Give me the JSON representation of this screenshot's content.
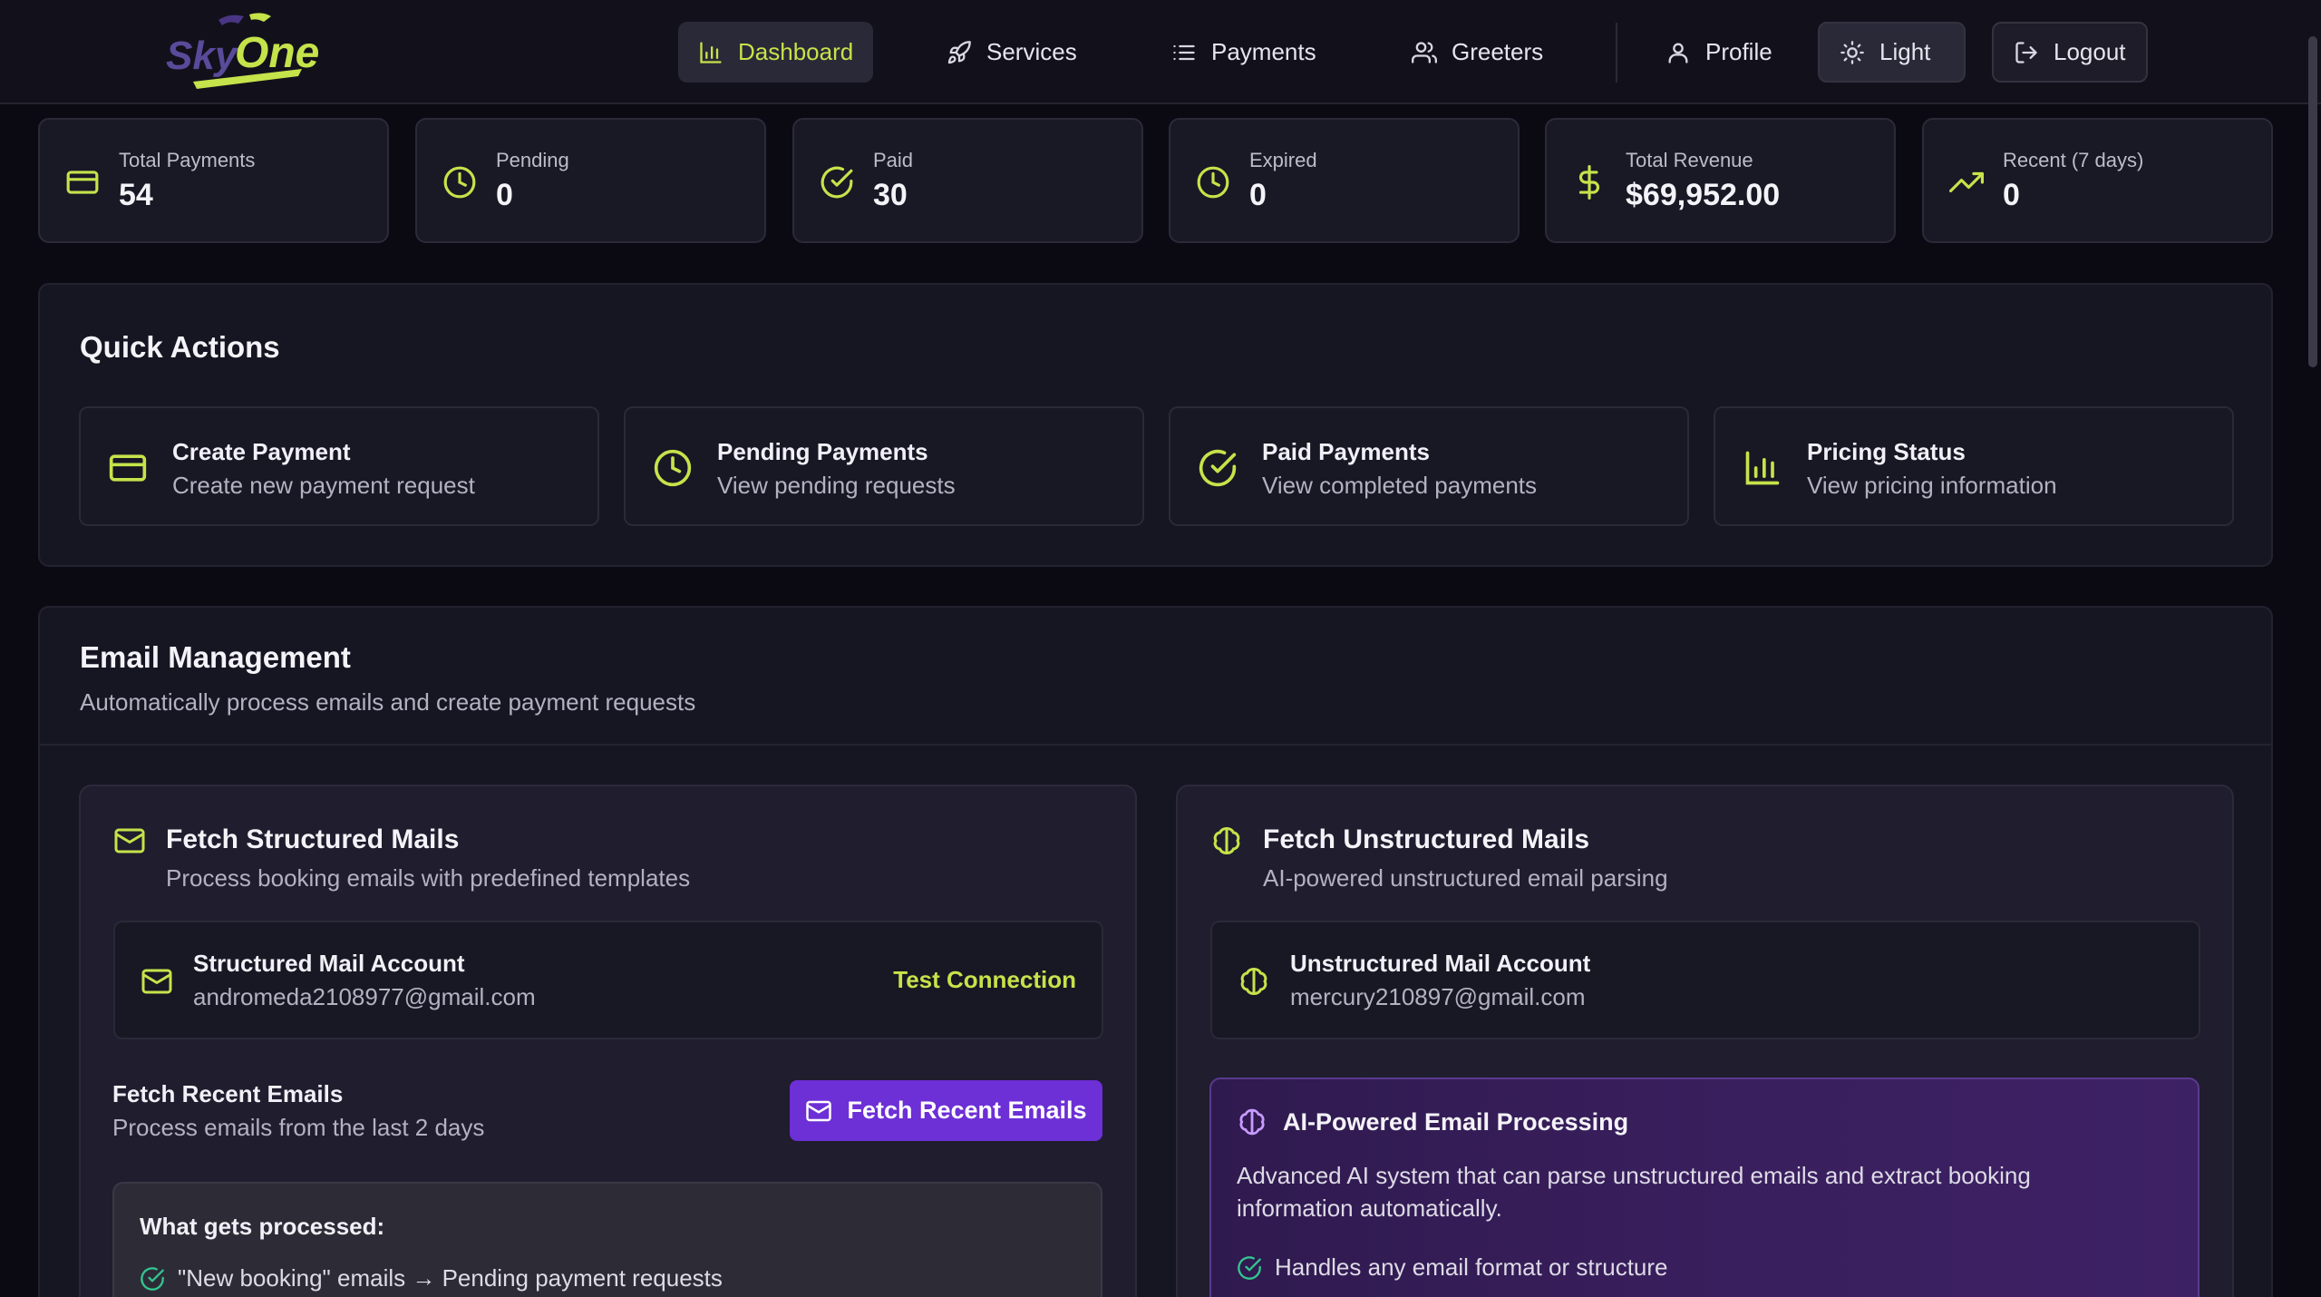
{
  "colors": {
    "accent": "#c5e34a",
    "primary_button": "#6d2fd6",
    "success": "#34c38f",
    "background": "#0b0a12"
  },
  "logo": {
    "text_sky": "Sky",
    "text_one": "One"
  },
  "nav": {
    "dashboard": "Dashboard",
    "services": "Services",
    "payments": "Payments",
    "greeters": "Greeters",
    "profile": "Profile",
    "theme": "Light",
    "logout": "Logout"
  },
  "stats": [
    {
      "label": "Total Payments",
      "value": "54",
      "icon": "credit-card-icon"
    },
    {
      "label": "Pending",
      "value": "0",
      "icon": "clock-icon"
    },
    {
      "label": "Paid",
      "value": "30",
      "icon": "check-circle-icon"
    },
    {
      "label": "Expired",
      "value": "0",
      "icon": "clock-icon"
    },
    {
      "label": "Total Revenue",
      "value": "$69,952.00",
      "icon": "dollar-icon"
    },
    {
      "label": "Recent (7 days)",
      "value": "0",
      "icon": "trending-up-icon"
    }
  ],
  "quick_actions": {
    "title": "Quick Actions",
    "items": [
      {
        "title": "Create Payment",
        "subtitle": "Create new payment request",
        "icon": "credit-card-icon"
      },
      {
        "title": "Pending Payments",
        "subtitle": "View pending requests",
        "icon": "clock-icon"
      },
      {
        "title": "Paid Payments",
        "subtitle": "View completed payments",
        "icon": "check-circle-icon"
      },
      {
        "title": "Pricing Status",
        "subtitle": "View pricing information",
        "icon": "bar-chart-icon"
      }
    ]
  },
  "email": {
    "title": "Email Management",
    "subtitle": "Automatically process emails and create payment requests",
    "structured": {
      "title": "Fetch Structured Mails",
      "subtitle": "Process booking emails with predefined templates",
      "account_label": "Structured Mail Account",
      "account_email": "andromeda2108977@gmail.com",
      "test_connection": "Test Connection",
      "fetch_title": "Fetch Recent Emails",
      "fetch_subtitle": "Process emails from the last 2 days",
      "fetch_button": "Fetch Recent Emails",
      "processed_title": "What gets processed:",
      "processed_items": [
        "\"New booking\" emails → Pending payment requests"
      ]
    },
    "unstructured": {
      "title": "Fetch Unstructured Mails",
      "subtitle": "AI-powered unstructured email parsing",
      "account_label": "Unstructured Mail Account",
      "account_email": "mercury210897@gmail.com",
      "ai_title": "AI-Powered Email Processing",
      "ai_description": "Advanced AI system that can parse unstructured emails and extract booking information automatically.",
      "ai_features": [
        "Handles any email format or structure"
      ]
    }
  }
}
